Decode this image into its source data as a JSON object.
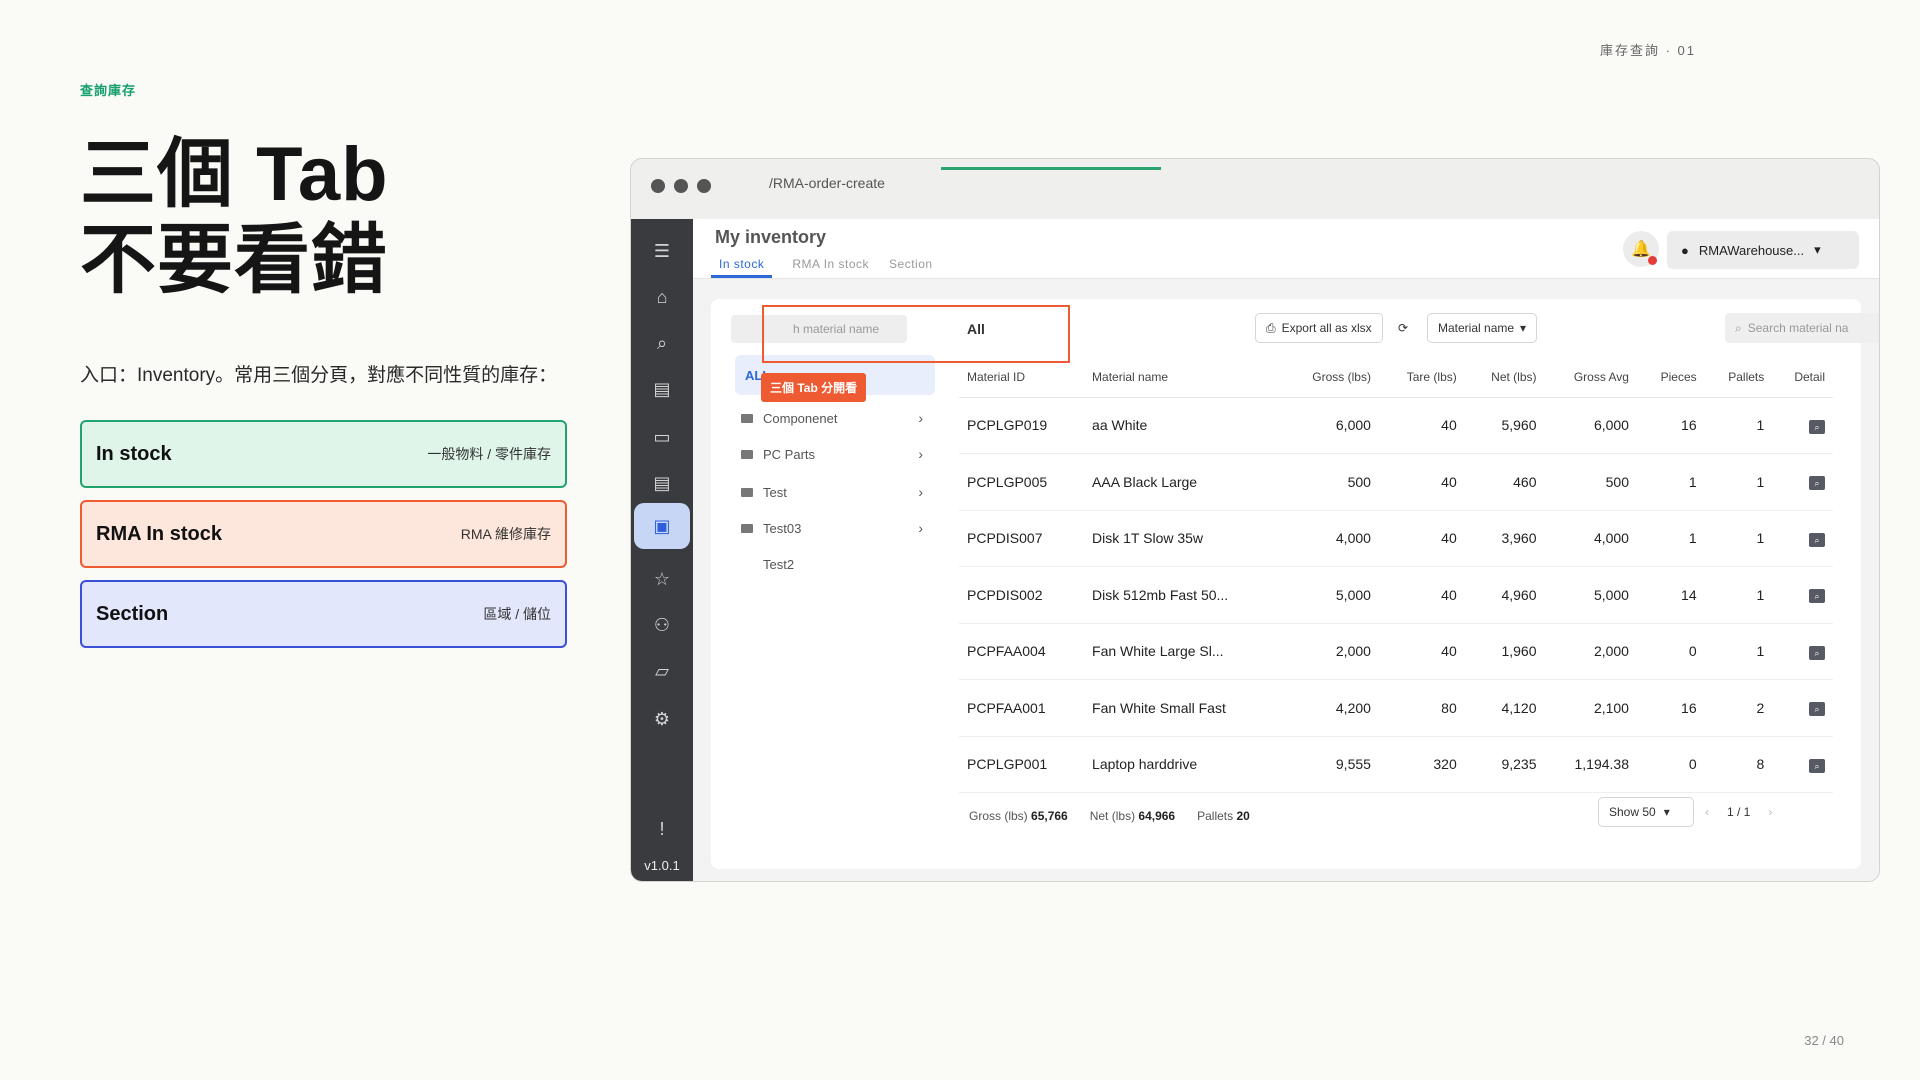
{
  "slide": {
    "kicker": "查詢庫存",
    "pageref": "庫存查詢 · 01",
    "headline_line1": "三個 Tab",
    "headline_line2": "不要看錯",
    "intro": "入口：Inventory。常用三個分頁，對應不同性質的庫存：",
    "cards": [
      {
        "title": "In stock",
        "sub": "一般物料 / 零件庫存"
      },
      {
        "title": "RMA In stock",
        "sub": "RMA 維修庫存"
      },
      {
        "title": "Section",
        "sub": "區域 / 儲位"
      }
    ],
    "page": "32 / 40"
  },
  "browser": {
    "url": "/RMA-order-create"
  },
  "app": {
    "title": "My inventory",
    "tabs": [
      "In stock",
      "RMA In stock",
      "Section"
    ],
    "user": "RMAWarehouse...",
    "version": "v1.0.1",
    "callout": "三個 Tab 分開看",
    "left_search_placeholder": "h material name",
    "nav_all": "ALL",
    "nav_items": [
      "Componenet",
      "PC Parts",
      "Test",
      "Test03",
      "Test2"
    ],
    "main_title": "All",
    "export_label": "Export all as xlsx",
    "filter_label": "Material name",
    "search_placeholder": "Search material na",
    "columns": [
      "Material ID",
      "Material name",
      "Gross (lbs)",
      "Tare (lbs)",
      "Net (lbs)",
      "Gross Avg",
      "Pieces",
      "Pallets",
      "Detail"
    ],
    "rows": [
      [
        "PCPLGP019",
        "aa White",
        "6,000",
        "40",
        "5,960",
        "6,000",
        "16",
        "1"
      ],
      [
        "PCPLGP005",
        "AAA Black Large",
        "500",
        "40",
        "460",
        "500",
        "1",
        "1"
      ],
      [
        "PCPDIS007",
        "Disk 1T Slow 35w",
        "4,000",
        "40",
        "3,960",
        "4,000",
        "1",
        "1"
      ],
      [
        "PCPDIS002",
        "Disk 512mb Fast 50...",
        "5,000",
        "40",
        "4,960",
        "5,000",
        "14",
        "1"
      ],
      [
        "PCPFAA004",
        "Fan White Large Sl...",
        "2,000",
        "40",
        "1,960",
        "2,000",
        "0",
        "1"
      ],
      [
        "PCPFAA001",
        "Fan White Small Fast",
        "4,200",
        "80",
        "4,120",
        "2,100",
        "16",
        "2"
      ],
      [
        "PCPLGP001",
        "Laptop harddrive",
        "9,555",
        "320",
        "9,235",
        "1,194.38",
        "0",
        "8"
      ]
    ],
    "footer": {
      "gross_label": "Gross (lbs)",
      "gross_value": "65,766",
      "net_label": "Net (lbs)",
      "net_value": "64,966",
      "pallets_label": "Pallets",
      "pallets_value": "20"
    },
    "show_label": "Show 50",
    "pager": "1 / 1"
  }
}
